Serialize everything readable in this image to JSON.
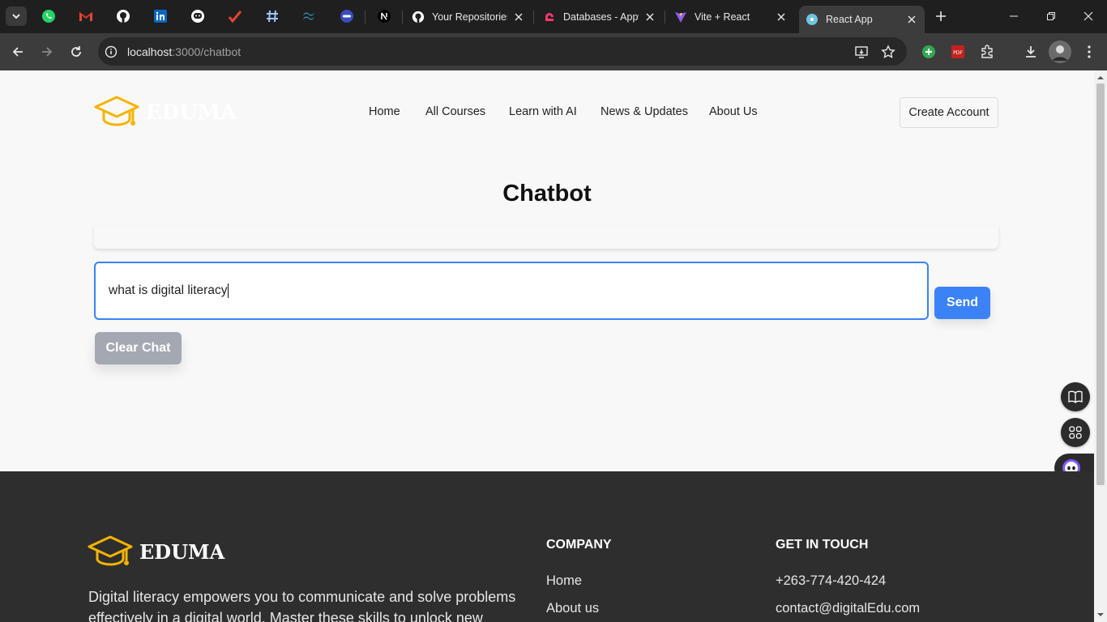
{
  "browser": {
    "tabs": [
      {
        "title": "Your Repositories",
        "favicon": "github-icon"
      },
      {
        "title": "Databases - Appwrite",
        "favicon": "appwrite-icon"
      },
      {
        "title": "Vite + React",
        "favicon": "vite-icon"
      },
      {
        "title": "React App",
        "favicon": "react-icon",
        "active": true
      }
    ],
    "pinned_tabs": [
      "whatsapp-icon",
      "gmail-icon",
      "github-icon",
      "linkedin-icon",
      "chat-icon",
      "tick-icon",
      "hashtag-icon",
      "tailwind-icon",
      "extension-icon",
      "nextjs-icon"
    ],
    "url_host": "localhost",
    "url_path": ":3000/chatbot"
  },
  "site": {
    "logo_text": "EDUMA",
    "nav": [
      "Home",
      "All Courses",
      "Learn with AI",
      "News & Updates",
      "About Us"
    ],
    "create_account": "Create Account"
  },
  "chatbot": {
    "title": "Chatbot",
    "input_value": "what is digital literacy",
    "send_label": "Send",
    "clear_label": "Clear Chat"
  },
  "footer": {
    "logo_text": "EDUMA",
    "description": "Digital literacy empowers you to communicate and solve problems effectively in a digital world. Master these skills to unlock new",
    "company_heading": "COMPANY",
    "company_links": [
      "Home",
      "About us"
    ],
    "contact_heading": "GET IN TOUCH",
    "phone": "+263-774-420-424",
    "email": "contact@digitalEdu.com"
  },
  "colors": {
    "accent": "#3b82f6",
    "logo_yellow": "#f5b400",
    "footer_bg": "#2e2e2e",
    "clear_button": "#a3a8b2"
  }
}
